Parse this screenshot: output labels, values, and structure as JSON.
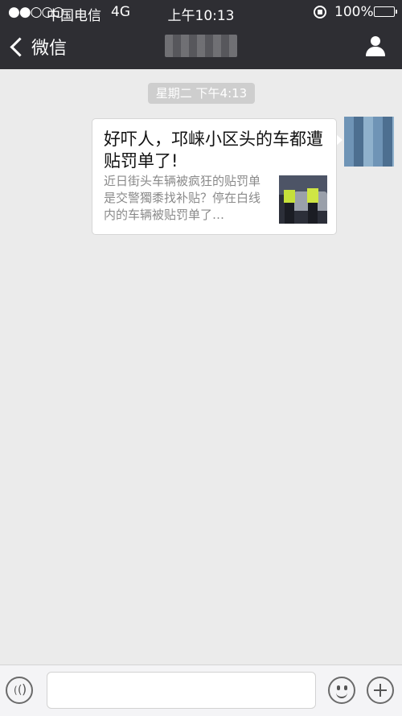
{
  "status_bar": {
    "signal": "●●○○○",
    "carrier": "中国电信",
    "network": "4G",
    "time": "上午10:13",
    "battery": "100%"
  },
  "nav": {
    "back_label": "微信"
  },
  "chat": {
    "timestamp": "星期二 下午4:13",
    "messages": [
      {
        "type": "link-card",
        "title": "好吓人，邛崃小区头的车都遭贴罚单了!",
        "description": "近日街头车辆被疯狂的贴罚单是交警獨黍找补贴？停在白线内的车辆被贴罚单了…"
      }
    ]
  },
  "input_bar": {
    "placeholder": ""
  },
  "colors": {
    "header_bg": "#2e2e33",
    "chat_bg": "#ebebeb",
    "bubble_bg": "#ffffff",
    "timestamp_bg": "#cecece"
  },
  "icons": [
    "back-chevron-icon",
    "profile-icon",
    "voice-icon",
    "emoji-icon",
    "plus-icon"
  ]
}
